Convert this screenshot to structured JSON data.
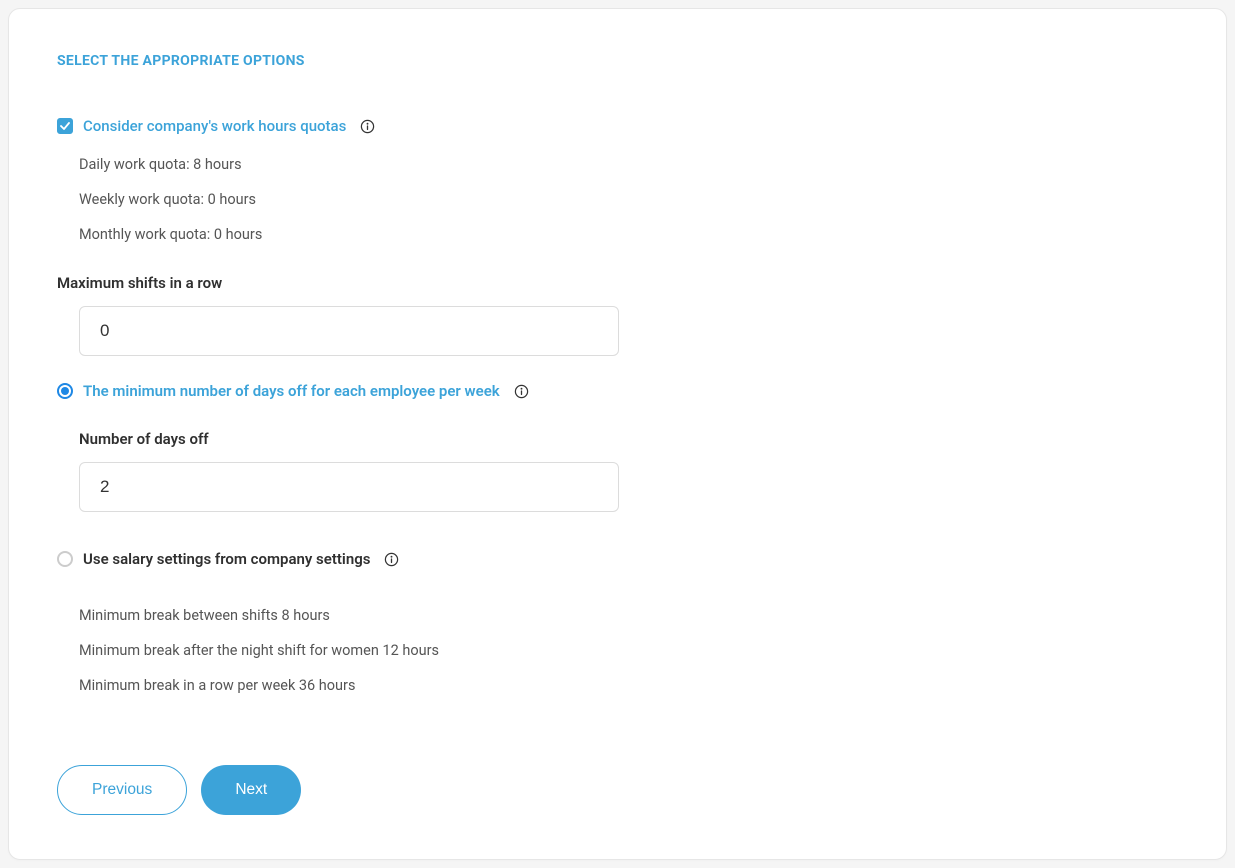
{
  "section_title": "SELECT THE APPROPRIATE OPTIONS",
  "options": {
    "quotas": {
      "label": "Consider company's work hours quotas",
      "rows": [
        "Daily work quota: 8 hours",
        "Weekly work quota: 0 hours",
        "Monthly work quota: 0 hours"
      ]
    },
    "max_shifts": {
      "label": "Maximum shifts in a row",
      "value": "0"
    },
    "days_off": {
      "label": "The minimum number of days off for each employee per week",
      "sub_label": "Number of days off",
      "value": "2"
    },
    "salary": {
      "label": "Use salary settings from company settings",
      "rows": [
        "Minimum break between shifts 8 hours",
        "Minimum break after the night shift for women 12 hours",
        "Minimum break in a row per week 36 hours"
      ]
    }
  },
  "buttons": {
    "previous": "Previous",
    "next": "Next"
  }
}
